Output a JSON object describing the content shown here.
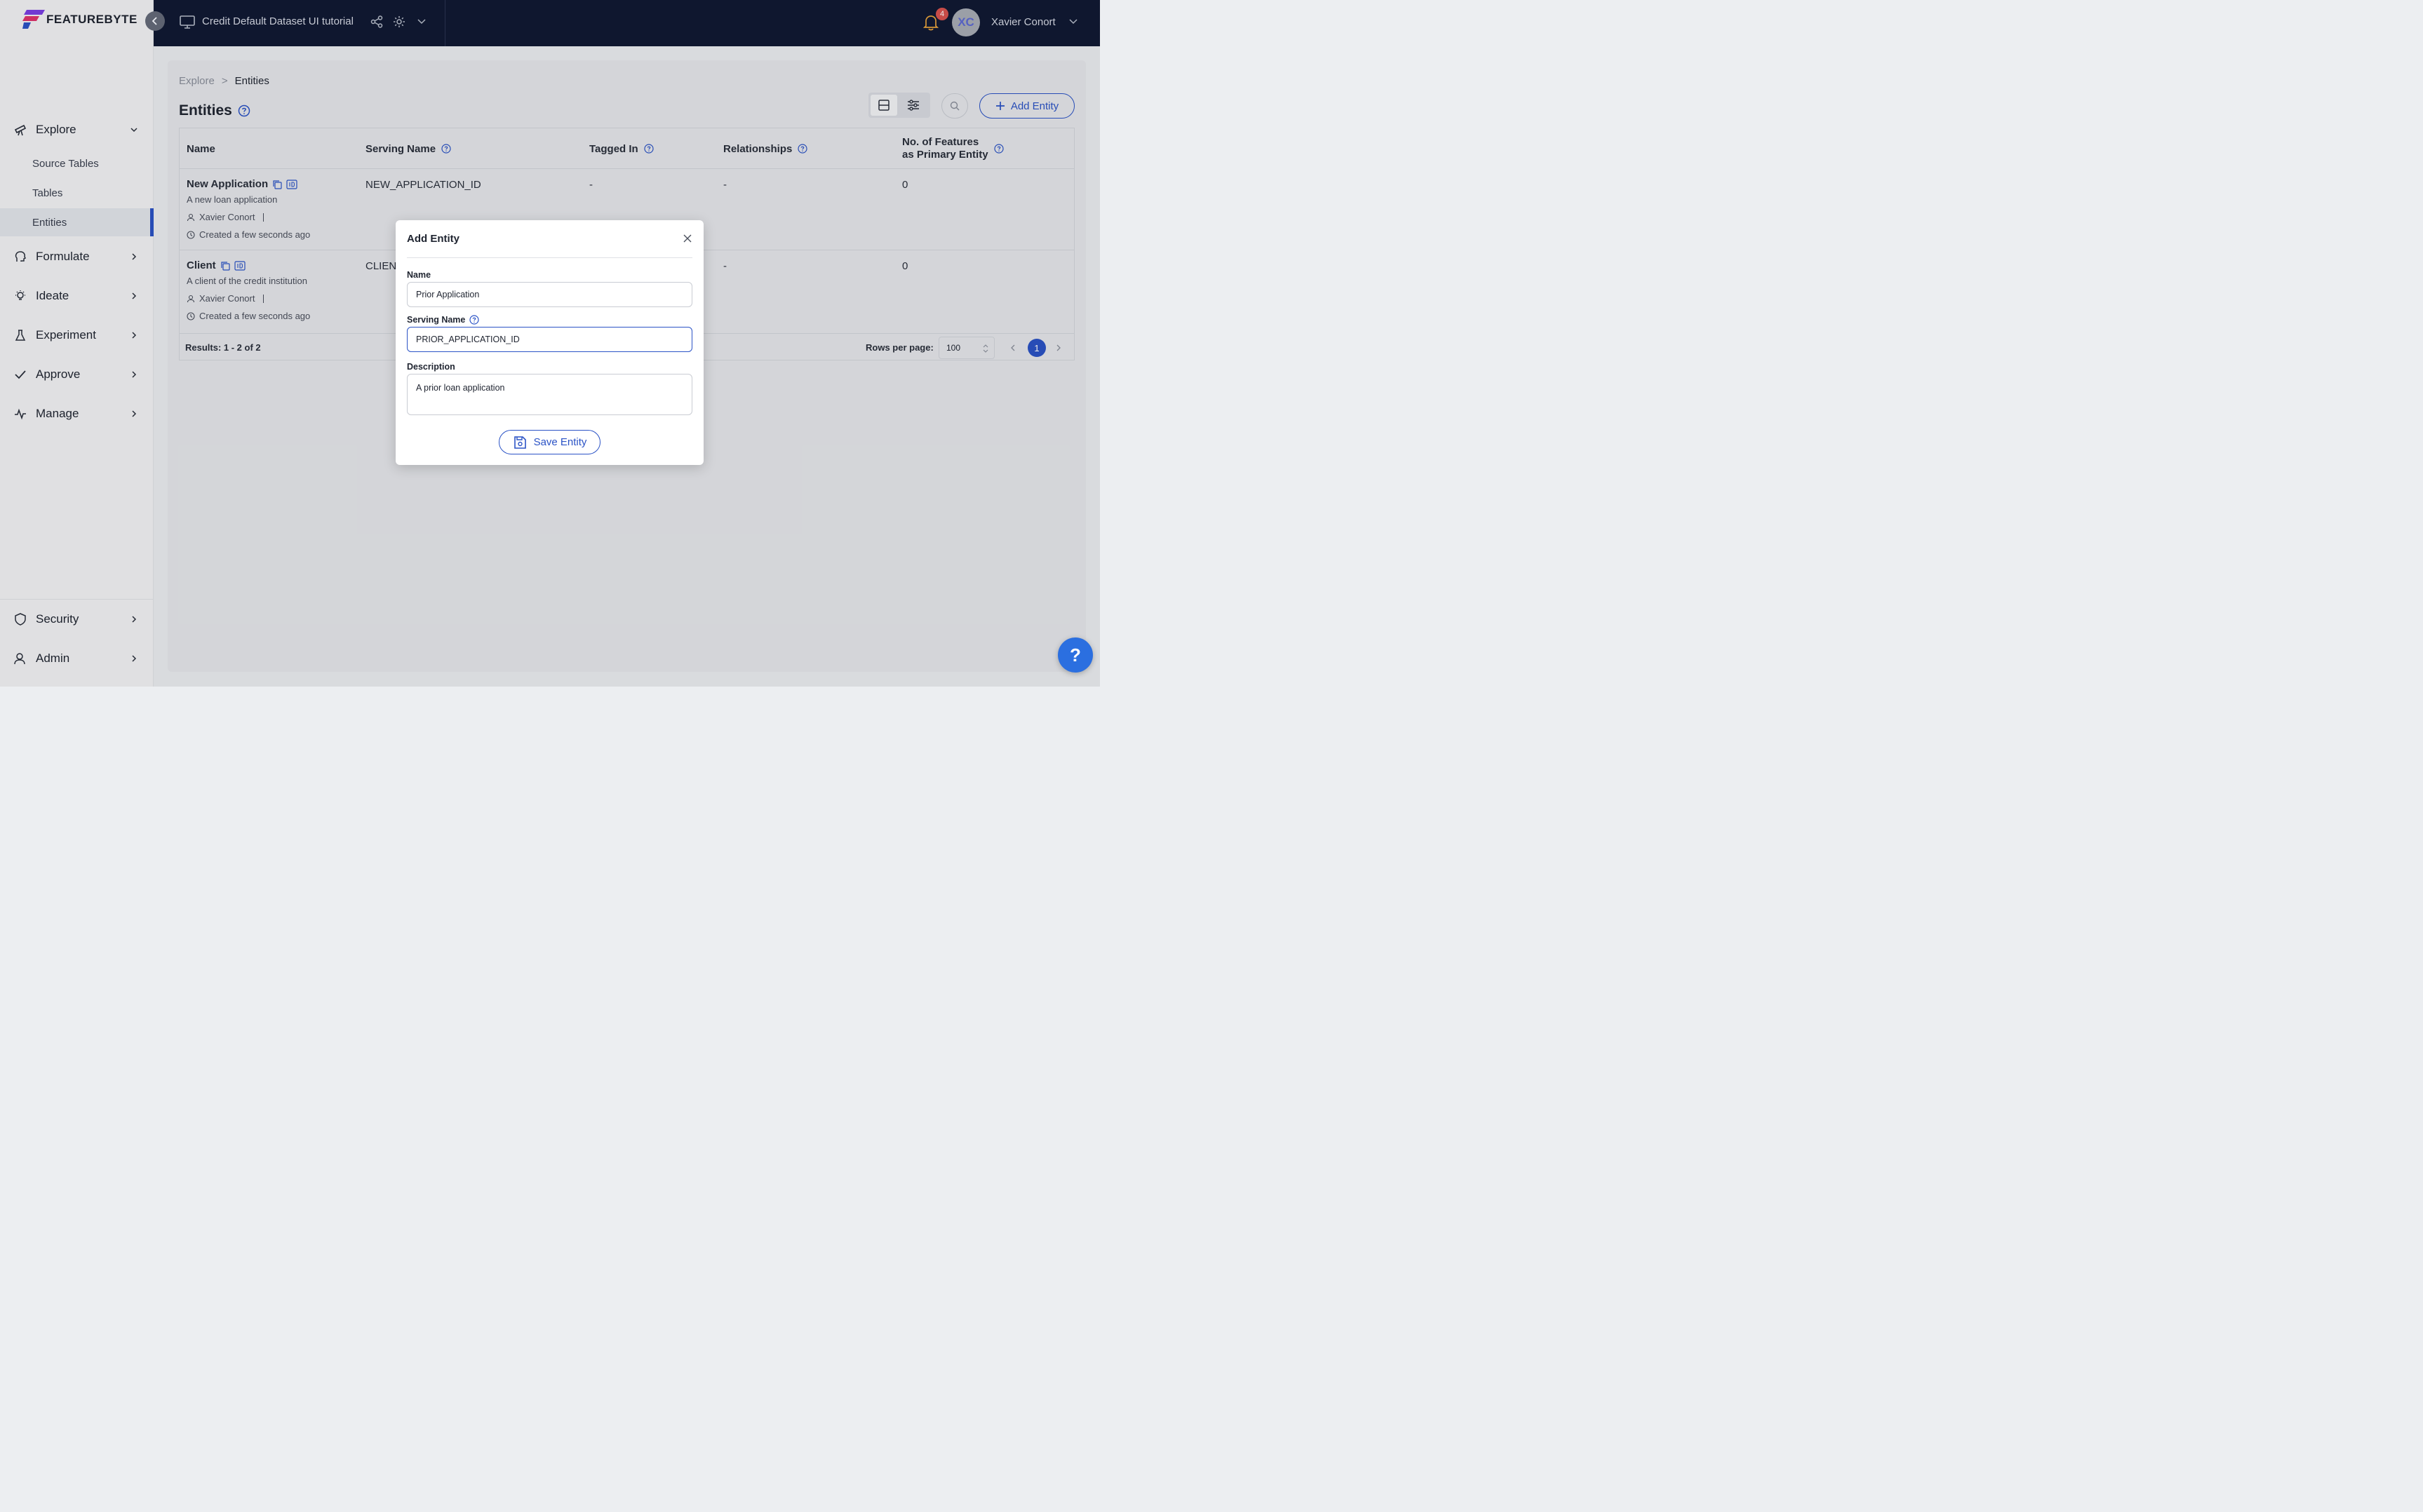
{
  "app": {
    "logo_text": "FEATUREBYTE",
    "catalog_title": "Credit Default Dataset UI tutorial",
    "notification_count": "4",
    "user_initials": "XC",
    "user_name": "Xavier Conort",
    "accent_color": "#2b53c6"
  },
  "sidebar": {
    "explore": "Explore",
    "explore_items": [
      "Source Tables",
      "Tables",
      "Entities"
    ],
    "formulate": "Formulate",
    "ideate": "Ideate",
    "experiment": "Experiment",
    "approve": "Approve",
    "manage": "Manage",
    "security": "Security",
    "admin": "Admin"
  },
  "breadcrumb": {
    "parent": "Explore",
    "separator": ">",
    "current": "Entities"
  },
  "page": {
    "title": "Entities",
    "add_button": "Add Entity"
  },
  "table": {
    "headers": {
      "name": "Name",
      "serving_name": "Serving Name",
      "tagged_in": "Tagged In",
      "relationships": "Relationships",
      "features_line1": "No. of Features",
      "features_line2": "as Primary Entity"
    },
    "rows": [
      {
        "name": "New Application",
        "description": "A new loan application",
        "owner": "Xavier Conort",
        "created": "Created a few seconds ago",
        "serving_name": "NEW_APPLICATION_ID",
        "tagged_in": "-",
        "relationships": "-",
        "features": "0"
      },
      {
        "name": "Client",
        "description": "A client of the credit institution",
        "owner": "Xavier Conort",
        "created": "Created a few seconds ago",
        "serving_name": "CLIENT",
        "tagged_in": "",
        "relationships": "-",
        "features": "0"
      }
    ],
    "results": "Results: 1 - 2 of 2",
    "rows_per_page_label": "Rows per page:",
    "rows_per_page": "100",
    "current_page": "1"
  },
  "modal": {
    "title": "Add Entity",
    "name_label": "Name",
    "name_value": "Prior Application",
    "serving_name_label": "Serving Name",
    "serving_name_value": "PRIOR_APPLICATION_ID",
    "description_label": "Description",
    "description_value": "A prior loan application",
    "save_button": "Save Entity"
  },
  "help_fab": "?"
}
